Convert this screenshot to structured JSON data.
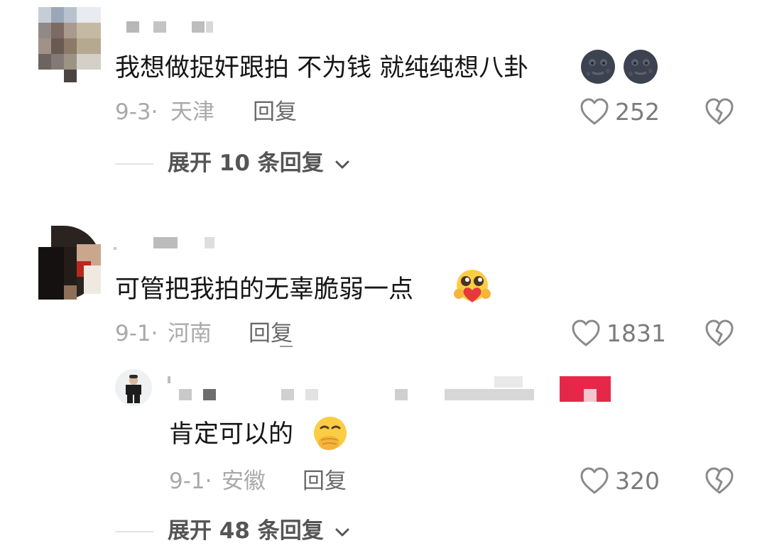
{
  "comments": [
    {
      "text": "我想做捉奸跟拍 不为钱 就纯纯想八卦",
      "date": "9-3·",
      "location": "天津",
      "reply_label": "回复",
      "likes": "252",
      "emojis": [
        "new-moon-face",
        "new-moon-face"
      ],
      "expand_label": "展开 10 条回复"
    },
    {
      "text": "可管把我拍的无辜脆弱一点",
      "date": "9-1·",
      "location": "河南",
      "reply_label": "回复",
      "likes": "1831",
      "emojis": [
        "pleading-heart-face"
      ],
      "replies": [
        {
          "text": "肯定可以的",
          "date": "9-1·",
          "location": "安徽",
          "reply_label": "回复",
          "likes": "320",
          "emojis": [
            "hand-over-mouth-face"
          ]
        }
      ],
      "expand_label": "展开 48 条回复"
    }
  ],
  "colors": {
    "author_badge": "#e5284a",
    "meta": "#a9a9a9",
    "reply": "#6a6a6a",
    "like": "#7b7b7b"
  }
}
